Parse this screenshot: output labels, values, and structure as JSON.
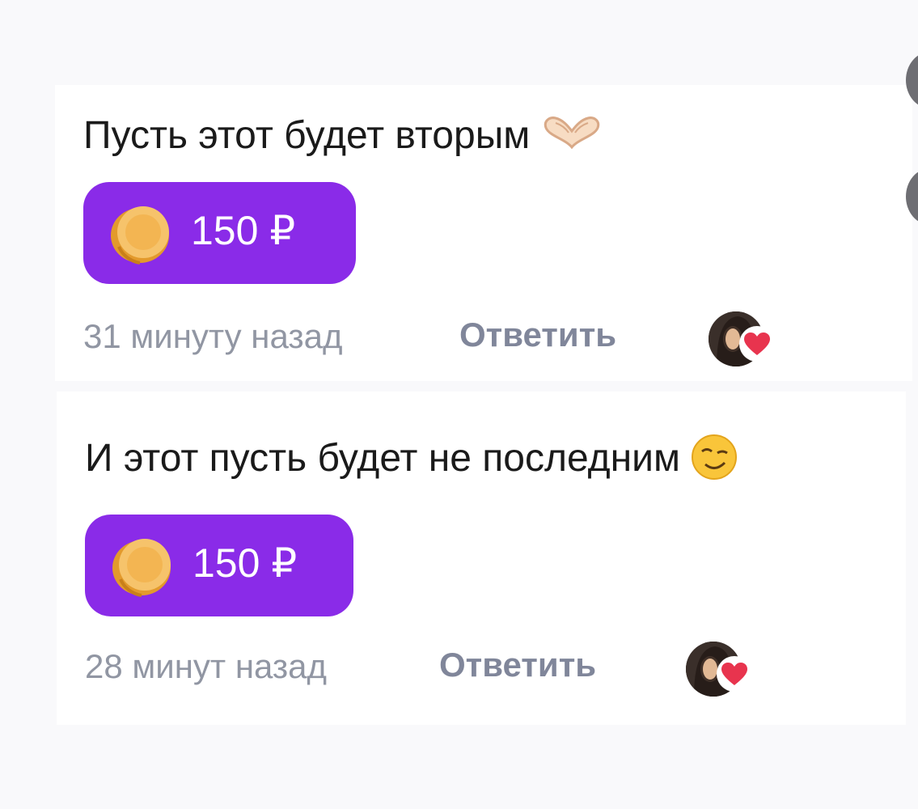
{
  "comments": [
    {
      "text": "Пусть этот будет вторым",
      "emoji_icon": "heart-hands-icon",
      "donation": {
        "amount": "150 ₽",
        "icon": "coin-icon",
        "color": "#8a2be8"
      },
      "time": "31 минуту назад",
      "reply_label": "Ответить",
      "liked_by_author": true
    },
    {
      "text": "И этот пусть будет не последним",
      "emoji_icon": "winking-face-icon",
      "donation": {
        "amount": "150 ₽",
        "icon": "coin-icon",
        "color": "#8a2be8"
      },
      "time": "28 минут назад",
      "reply_label": "Ответить",
      "liked_by_author": true
    }
  ],
  "colors": {
    "accent": "#8a2be8",
    "coin": "#f5b24a",
    "heart": "#e8344e",
    "muted_text": "#9196a3",
    "reply_text": "#80869a"
  }
}
